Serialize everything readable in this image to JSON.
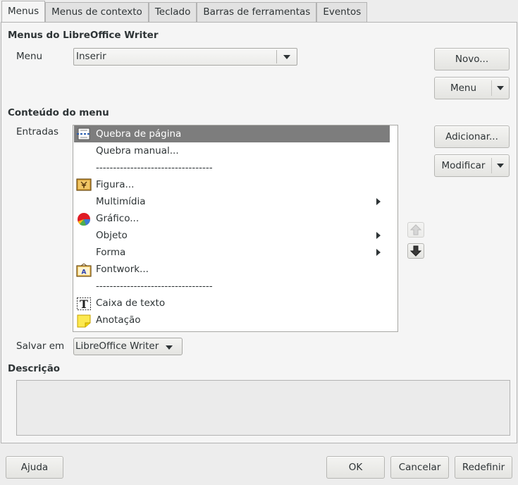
{
  "tabs": [
    "Menus",
    "Menus de contexto",
    "Teclado",
    "Barras de ferramentas",
    "Eventos"
  ],
  "section_menus": {
    "heading": "Menus do LibreOffice Writer",
    "menu_label": "Menu",
    "menu_value": "Inserir",
    "new_button": "Novo...",
    "menu_button": "Menu"
  },
  "section_content": {
    "heading": "Conteúdo do menu",
    "entries_label": "Entradas",
    "add_button": "Adicionar...",
    "modify_button": "Modificar",
    "entries": [
      {
        "label": "Quebra de página",
        "icon": "page-break-icon",
        "selected": true,
        "submenu": false
      },
      {
        "label": "Quebra manual...",
        "icon": "",
        "selected": false,
        "submenu": false
      },
      {
        "label": "----------------------------------",
        "icon": "",
        "selected": false,
        "submenu": false
      },
      {
        "label": "Figura...",
        "icon": "image-icon",
        "selected": false,
        "submenu": false
      },
      {
        "label": "Multimídia",
        "icon": "",
        "selected": false,
        "submenu": true
      },
      {
        "label": "Gráfico...",
        "icon": "pie-chart-icon",
        "selected": false,
        "submenu": false
      },
      {
        "label": "Objeto",
        "icon": "",
        "selected": false,
        "submenu": true
      },
      {
        "label": "Forma",
        "icon": "",
        "selected": false,
        "submenu": true
      },
      {
        "label": "Fontwork...",
        "icon": "fontwork-icon",
        "selected": false,
        "submenu": false
      },
      {
        "label": "----------------------------------",
        "icon": "",
        "selected": false,
        "submenu": false
      },
      {
        "label": "Caixa de texto",
        "icon": "text-box-icon",
        "selected": false,
        "submenu": false
      },
      {
        "label": "Anotação",
        "icon": "note-icon",
        "selected": false,
        "submenu": false
      }
    ]
  },
  "save_in": {
    "label": "Salvar em",
    "value": "LibreOffice Writer"
  },
  "description": {
    "heading": "Descrição",
    "text": ""
  },
  "footer": {
    "help": "Ajuda",
    "ok": "OK",
    "cancel": "Cancelar",
    "reset": "Redefinir"
  },
  "colors": {
    "selection": "#7d7d7d",
    "panel": "#f5f5f5",
    "window": "#ededed"
  }
}
